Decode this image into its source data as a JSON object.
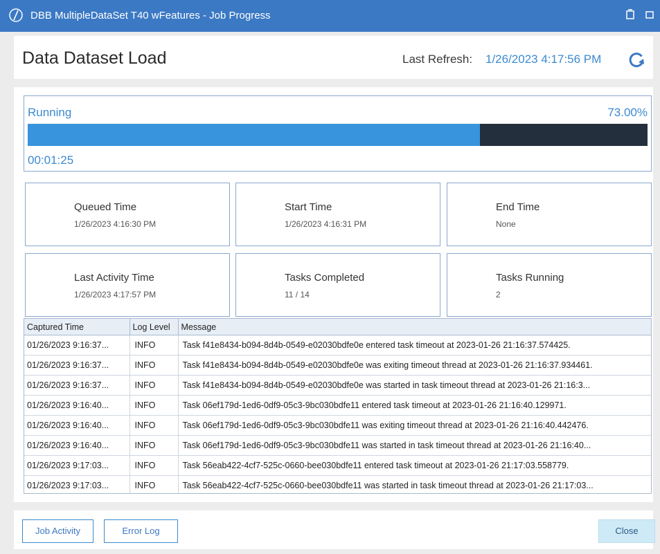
{
  "window": {
    "title": "DBB MultipleDataSet T40 wFeatures - Job Progress",
    "icon": "app-logo-icon",
    "controls": [
      "restore-icon",
      "maximize-icon"
    ]
  },
  "header": {
    "title": "Data Dataset Load",
    "last_refresh_label": "Last Refresh:",
    "last_refresh_value": "1/26/2023 4:17:56 PM",
    "refresh_icon": "refresh-icon"
  },
  "progress": {
    "status": "Running",
    "percent_text": "73.00%",
    "percent_value": 0.73,
    "elapsed": "00:01:25"
  },
  "cards": [
    {
      "label": "Queued Time",
      "value": "1/26/2023 4:16:30 PM"
    },
    {
      "label": "Start Time",
      "value": "1/26/2023 4:16:31 PM"
    },
    {
      "label": "End Time",
      "value": "None"
    },
    {
      "label": "Last Activity Time",
      "value": "1/26/2023 4:17:57 PM"
    },
    {
      "label": "Tasks Completed",
      "value": "11 / 14"
    },
    {
      "label": "Tasks Running",
      "value": "2"
    }
  ],
  "log": {
    "columns": [
      "Captured Time",
      "Log Level",
      "Message"
    ],
    "rows": [
      {
        "time": "01/26/2023 9:16:37...",
        "level": "INFO",
        "message": "Task f41e8434-b094-8d4b-0549-e02030bdfe0e entered task timeout at 2023-01-26 21:16:37.574425."
      },
      {
        "time": "01/26/2023 9:16:37...",
        "level": "INFO",
        "message": "Task f41e8434-b094-8d4b-0549-e02030bdfe0e was exiting timeout thread at 2023-01-26 21:16:37.934461."
      },
      {
        "time": "01/26/2023 9:16:37...",
        "level": "INFO",
        "message": "Task f41e8434-b094-8d4b-0549-e02030bdfe0e was started in task timeout thread at 2023-01-26 21:16:3..."
      },
      {
        "time": "01/26/2023 9:16:40...",
        "level": "INFO",
        "message": "Task 06ef179d-1ed6-0df9-05c3-9bc030bdfe11 entered task timeout at 2023-01-26 21:16:40.129971."
      },
      {
        "time": "01/26/2023 9:16:40...",
        "level": "INFO",
        "message": "Task 06ef179d-1ed6-0df9-05c3-9bc030bdfe11 was exiting timeout thread at 2023-01-26 21:16:40.442476."
      },
      {
        "time": "01/26/2023 9:16:40...",
        "level": "INFO",
        "message": "Task 06ef179d-1ed6-0df9-05c3-9bc030bdfe11 was started in task timeout thread at 2023-01-26 21:16:40..."
      },
      {
        "time": "01/26/2023 9:17:03...",
        "level": "INFO",
        "message": "Task 56eab422-4cf7-525c-0660-bee030bdfe11 entered task timeout at 2023-01-26 21:17:03.558779."
      },
      {
        "time": "01/26/2023 9:17:03...",
        "level": "INFO",
        "message": "Task 56eab422-4cf7-525c-0660-bee030bdfe11 was started in task timeout thread at 2023-01-26 21:17:03..."
      }
    ]
  },
  "footer": {
    "job_activity_label": "Job Activity",
    "error_log_label": "Error Log",
    "close_label": "Close"
  }
}
